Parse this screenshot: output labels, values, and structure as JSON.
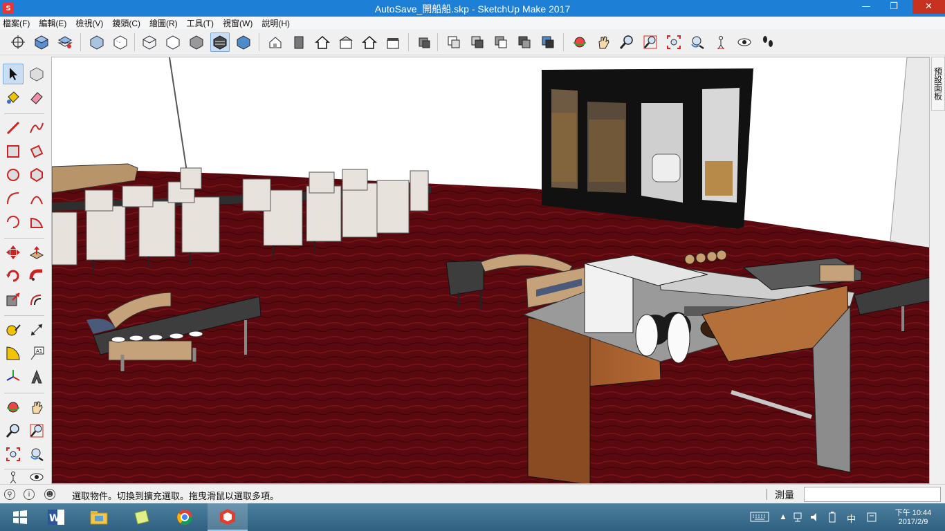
{
  "window": {
    "title": "AutoSave_開船船.skp - SketchUp Make 2017",
    "minimize": "—",
    "restore": "❐",
    "close": "✕",
    "app_icon": "sketchup-icon"
  },
  "menu": {
    "items": [
      {
        "label": "檔案(F)"
      },
      {
        "label": "編輯(E)"
      },
      {
        "label": "檢視(V)"
      },
      {
        "label": "鏡頭(C)"
      },
      {
        "label": "繪圖(R)"
      },
      {
        "label": "工具(T)"
      },
      {
        "label": "視窗(W)"
      },
      {
        "label": "說明(H)"
      }
    ]
  },
  "toolbar": {
    "icons": [
      "crosshair-icon",
      "component-icon",
      "layers-icon",
      "xray-style-icon",
      "back-edges-icon",
      "wireframe-icon",
      "hidden-line-icon",
      "shaded-icon",
      "shaded-texture-icon",
      "monochrome-icon",
      "iso-view-icon",
      "front-view-icon",
      "home-icon",
      "top-view-icon",
      "right-view-icon",
      "back-view-icon",
      "left-view-icon",
      "section-plane-icon",
      "outer-shell-icon",
      "intersect-icon",
      "union-icon",
      "subtract-icon",
      "trim-icon",
      "split-icon",
      "orbit-icon",
      "pan-icon",
      "zoom-icon",
      "zoom-window-icon",
      "zoom-extents-icon",
      "previous-view-icon",
      "position-camera-icon",
      "look-around-icon",
      "walk-icon"
    ],
    "active_icon": "monochrome-icon"
  },
  "palette": {
    "icons": [
      "select-icon",
      "make-component-icon",
      "paint-bucket-icon",
      "eraser-icon",
      "pencil-icon",
      "freehand-icon",
      "rectangle-icon",
      "rotated-rectangle-icon",
      "circle-icon",
      "polygon-icon",
      "arc-icon",
      "two-point-arc-icon",
      "three-point-arc-icon",
      "pie-icon",
      "move-icon",
      "push-pull-icon",
      "rotate-icon",
      "follow-me-icon",
      "scale-icon",
      "offset-icon",
      "tape-measure-icon",
      "dimension-icon",
      "protractor-icon",
      "text-icon",
      "axes-icon",
      "3d-text-icon",
      "orbit-icon",
      "pan-icon",
      "zoom-icon",
      "zoom-window-icon",
      "zoom-extents-icon",
      "previous-icon",
      "position-camera-icon",
      "look-around-icon"
    ],
    "active_icon": "select-icon"
  },
  "tray": {
    "tab_label": "預設面板"
  },
  "status": {
    "text": "選取物件。切換到擴充選取。拖曳滑鼠以選取多項。",
    "measure_label": "測量",
    "measure_value": "",
    "icons": [
      "geo-location-icon",
      "credits-icon",
      "user-icon"
    ]
  },
  "taskbar": {
    "apps": [
      "windows-start-icon",
      "word-icon",
      "file-explorer-icon",
      "sticky-notes-icon",
      "chrome-icon",
      "sketchup-icon"
    ],
    "active_app": "sketchup-icon",
    "tray": {
      "ime": "中",
      "time": "下午 10:44",
      "date": "2017/2/9"
    }
  },
  "colors": {
    "titlebar": "#1e7fd6",
    "close": "#c7311f",
    "floor": "#5a0a0e",
    "taskbar": "#3b6f8f",
    "active_tool": "#c9def5"
  }
}
